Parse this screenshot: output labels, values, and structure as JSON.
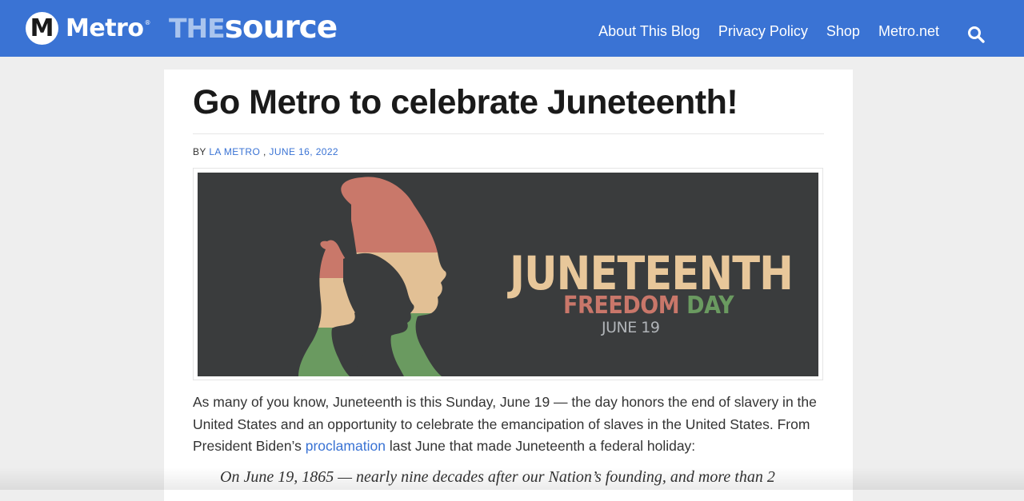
{
  "header": {
    "metro_logo_letter": "M",
    "metro_name": "Metro",
    "trademark": "®",
    "blog_name_prefix": "THE",
    "blog_name": "source",
    "nav": [
      {
        "label": "About This Blog"
      },
      {
        "label": "Privacy Policy"
      },
      {
        "label": "Shop"
      },
      {
        "label": "Metro.net"
      }
    ],
    "search_icon": "search-icon",
    "bar_color": "#3a73d4"
  },
  "article": {
    "title": "Go Metro to celebrate Juneteenth!",
    "byline": {
      "prefix": "BY",
      "author": "LA METRO",
      "separator": ",",
      "date": "JUNE 16, 2022"
    },
    "hero": {
      "headline": "JUNETEENTH",
      "subtitle_1": "FREEDOM",
      "subtitle_2": "DAY",
      "date": "JUNE 19"
    },
    "paragraph": {
      "before_link": "As many of you know, Juneteenth is this Sunday, June 19  — the day honors the end of slavery in the United States and an opportunity to celebrate the emancipation of slaves in the United States. From President Biden’s",
      "link": "proclamation",
      "after_link": "last June that made Juneteenth a federal holiday:"
    },
    "quote": "On June 19, 1865 — nearly nine decades after our Nation’s founding, and more than 2"
  }
}
